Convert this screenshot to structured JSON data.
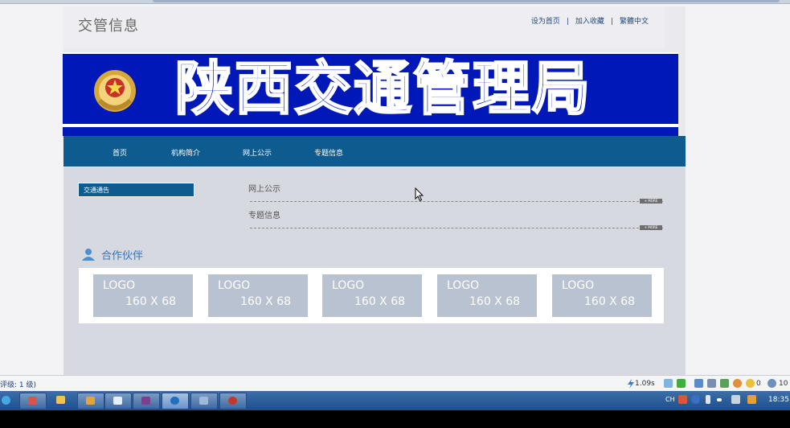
{
  "header": {
    "site_title": "交管信息",
    "links": [
      "设为首页",
      "加入收藏",
      "繁體中文"
    ],
    "separator": "|"
  },
  "banner": {
    "title": "陕西交通管理局",
    "emblem": "police-emblem-icon"
  },
  "nav": {
    "items": [
      "首页",
      "机构简介",
      "网上公示",
      "专题信息"
    ]
  },
  "sidebar": {
    "active_item": "交通通告"
  },
  "main": {
    "sections": [
      {
        "title": "网上公示",
        "more": "+ MORE"
      },
      {
        "title": "专题信息",
        "more": "+ MORE"
      }
    ]
  },
  "partners": {
    "title": "合作伙伴",
    "icon": "person-icon",
    "logos": [
      {
        "line1": "LOGO",
        "line2": "160 X 68"
      },
      {
        "line1": "LOGO",
        "line2": "160 X 68"
      },
      {
        "line1": "LOGO",
        "line2": "160 X 68"
      },
      {
        "line1": "LOGO",
        "line2": "160 X 68"
      },
      {
        "line1": "LOGO",
        "line2": "160 X 68"
      }
    ]
  },
  "statusbar": {
    "left_text": "评级: 1 级)",
    "load_time": "1.09s",
    "count": "0",
    "zoom": "10"
  },
  "taskbar": {
    "lang": "CH",
    "clock": "18:35"
  },
  "colors": {
    "banner_blue": "#0018b8",
    "nav_blue": "#0d5b8f",
    "partner_blue": "#2a78c0"
  }
}
